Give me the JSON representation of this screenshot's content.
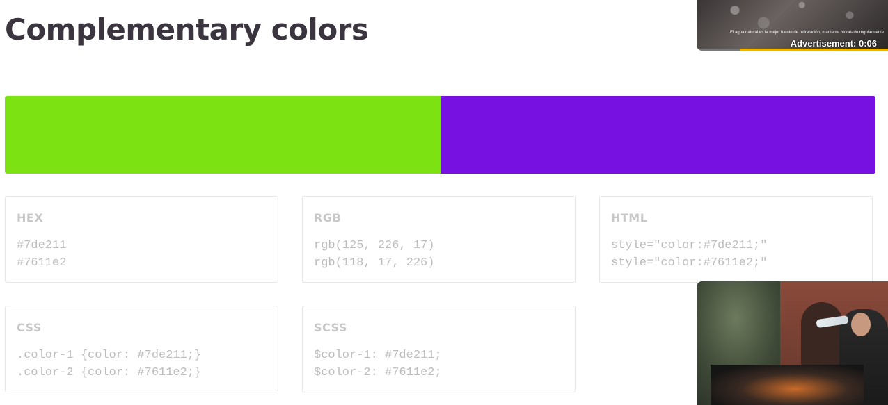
{
  "page": {
    "title": "Complementary colors"
  },
  "swatches": [
    {
      "name": "color-1",
      "hex": "#7de211"
    },
    {
      "name": "color-2",
      "hex": "#7611e2"
    }
  ],
  "cards": {
    "hex": {
      "title": "HEX",
      "lines": [
        "#7de211",
        "#7611e2"
      ]
    },
    "rgb": {
      "title": "RGB",
      "lines": [
        "rgb(125, 226, 17)",
        "rgb(118, 17, 226)"
      ]
    },
    "html": {
      "title": "HTML",
      "lines": [
        "style=\"color:#7de211;\"",
        "style=\"color:#7611e2;\""
      ]
    },
    "css": {
      "title": "CSS",
      "lines": [
        ".color-1 {color: #7de211;}",
        ".color-2 {color: #7611e2;}"
      ]
    },
    "scss": {
      "title": "SCSS",
      "lines": [
        "$color-1: #7de211;",
        "$color-2: #7611e2;"
      ]
    }
  },
  "ads": {
    "top": {
      "label": "Advertisement: 0:06",
      "subtitle": "El agua natural es la mejor fuente de hidratación, mantente hidratado regularmente",
      "progress_remaining": 0.77,
      "progress_color": "#f0b400"
    }
  }
}
